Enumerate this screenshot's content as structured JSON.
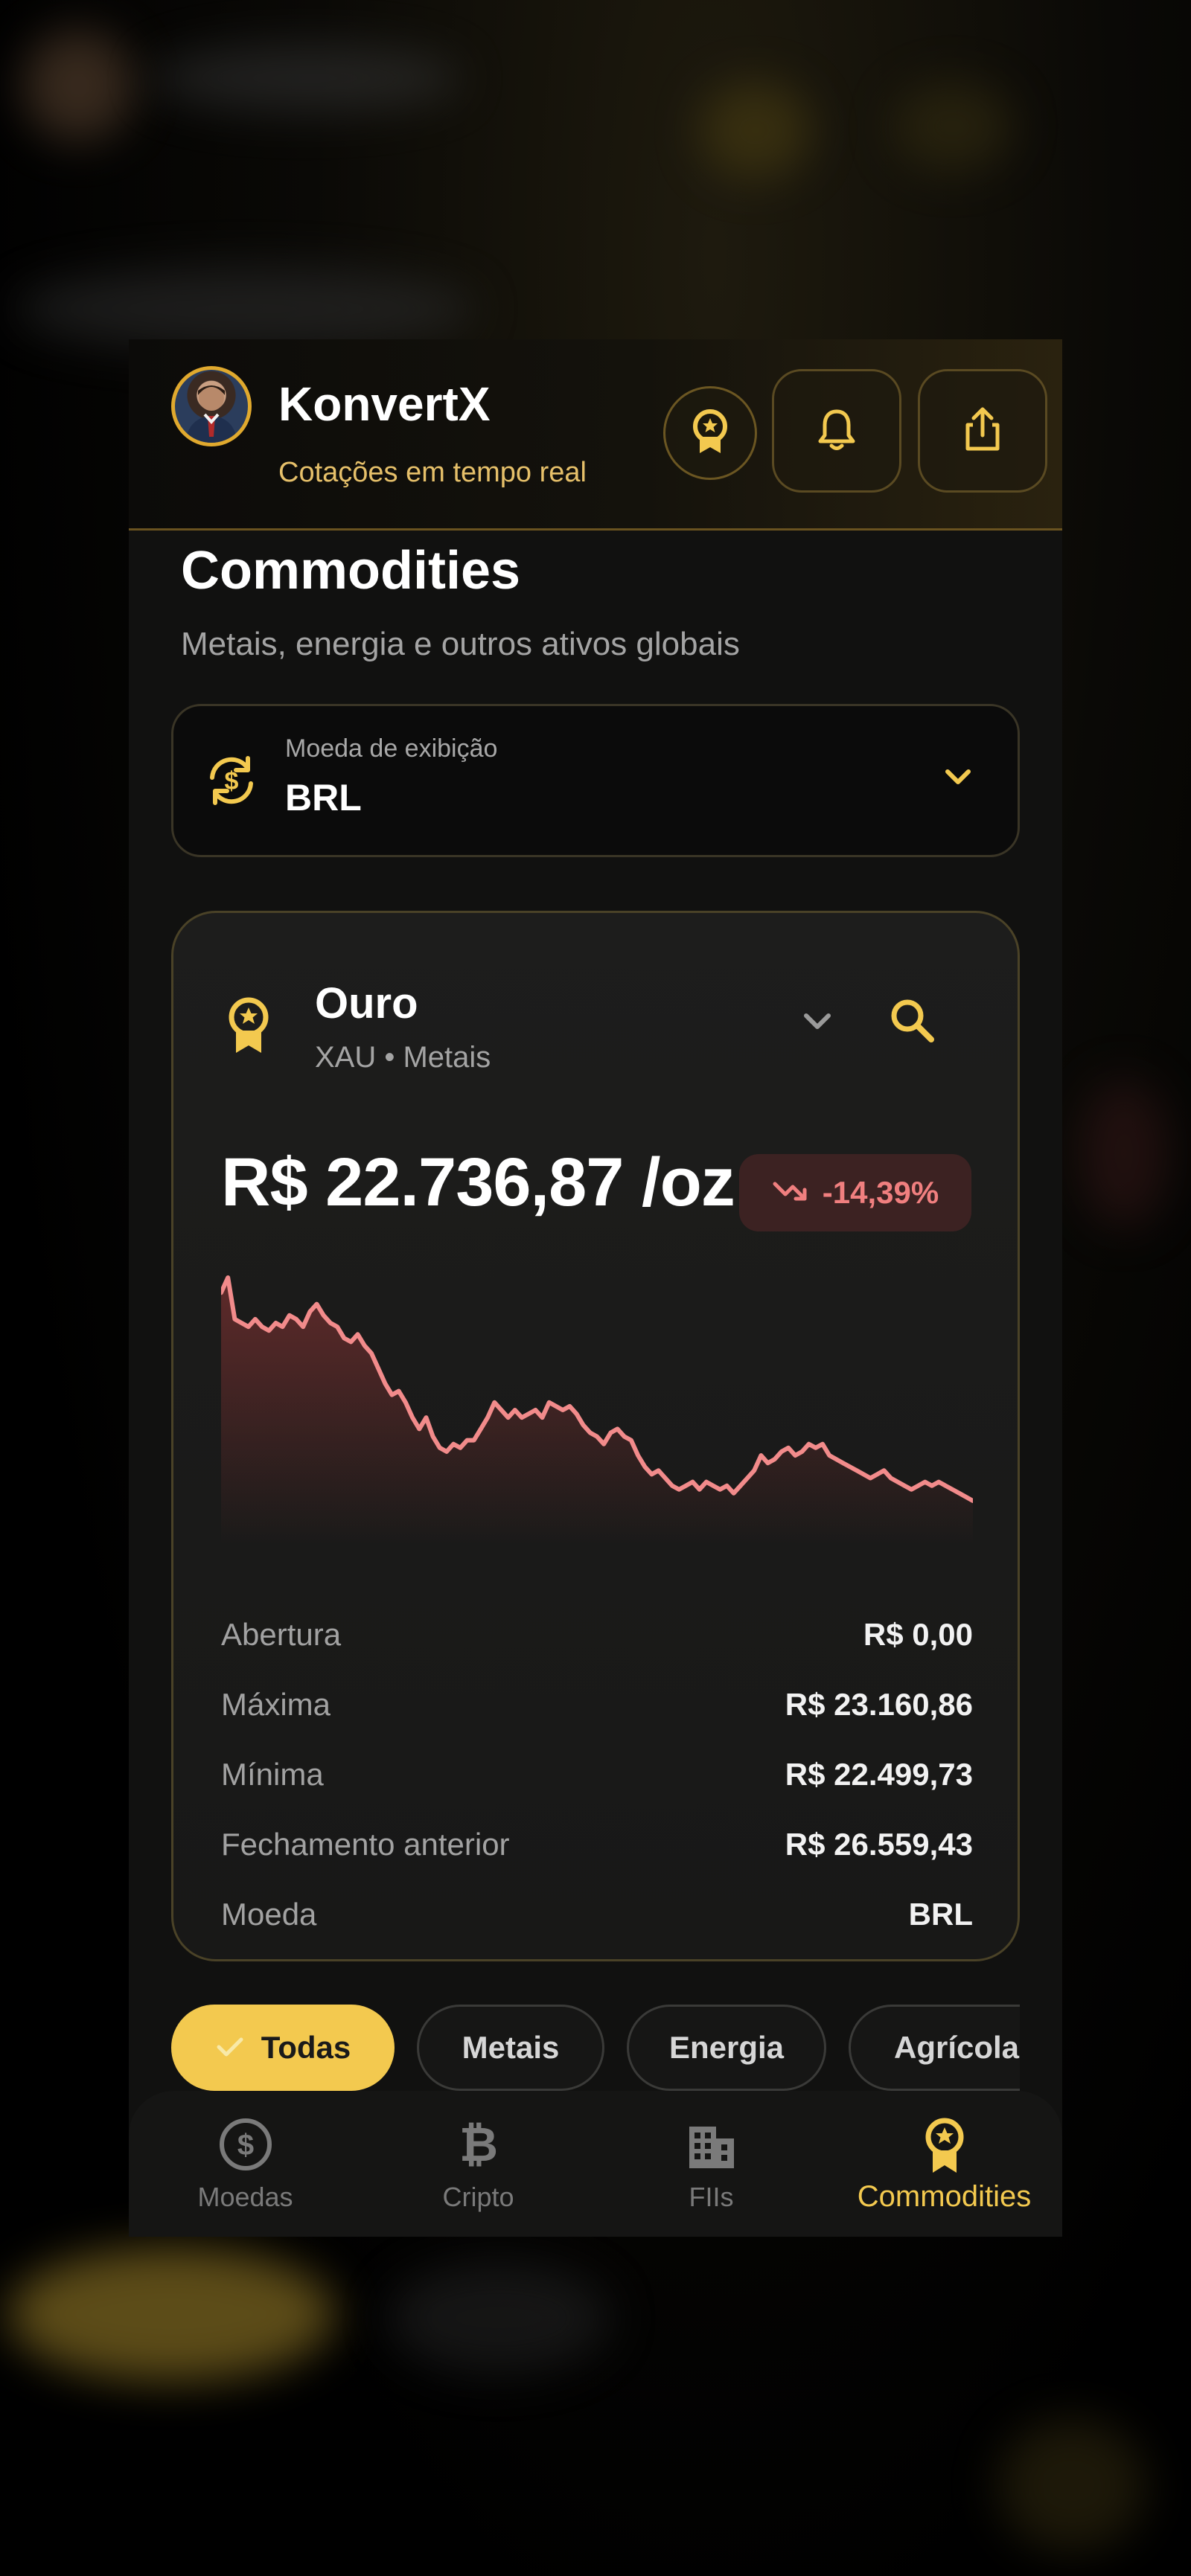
{
  "header": {
    "title": "KonvertX",
    "subtitle": "Cotações em tempo real"
  },
  "page": {
    "title": "Commodities",
    "subtitle": "Metais, energia e outros ativos globais"
  },
  "currency_selector": {
    "label": "Moeda de exibição",
    "value": "BRL"
  },
  "asset_card": {
    "name": "Ouro",
    "subtitle": "XAU • Metais",
    "price": "R$ 22.736,87 /oz",
    "change": "-14,39%",
    "change_color": "#f07f7f",
    "stats": [
      {
        "label": "Abertura",
        "value": "R$ 0,00"
      },
      {
        "label": "Máxima",
        "value": "R$ 23.160,86"
      },
      {
        "label": "Mínima",
        "value": "R$ 22.499,73"
      },
      {
        "label": "Fechamento anterior",
        "value": "R$ 26.559,43"
      },
      {
        "label": "Moeda",
        "value": "BRL"
      }
    ]
  },
  "chart_data": {
    "type": "area",
    "series": [
      {
        "values": [
          95,
          99,
          88,
          87,
          86,
          88,
          86,
          85,
          87,
          86,
          89,
          88,
          86,
          90,
          92,
          89,
          87,
          86,
          83,
          82,
          84,
          81,
          79,
          75,
          71,
          68,
          69,
          66,
          62,
          59,
          62,
          57,
          54,
          53,
          55,
          54,
          56,
          56,
          59,
          62,
          66,
          64,
          62,
          64,
          62,
          63,
          64,
          62,
          66,
          65,
          64,
          65,
          63,
          60,
          58,
          57,
          55,
          58,
          59,
          57,
          56,
          52,
          49,
          47,
          48,
          46,
          44,
          43,
          44,
          45,
          43,
          45,
          44,
          43,
          44,
          42,
          44,
          46,
          48,
          52,
          50,
          51,
          53,
          54,
          52,
          53,
          55,
          54,
          55,
          52,
          51,
          50,
          49,
          48,
          47,
          46,
          47,
          48,
          46,
          45,
          44,
          43,
          44,
          45,
          44,
          45,
          44,
          43,
          42,
          41,
          40
        ]
      }
    ],
    "line_color": "#f28b8b",
    "fill_color": "#6b2d2d",
    "axes_visible": false
  },
  "filters": [
    {
      "label": "Todas",
      "active": true
    },
    {
      "label": "Metais",
      "active": false
    },
    {
      "label": "Energia",
      "active": false
    },
    {
      "label": "Agrícolas",
      "active": false
    }
  ],
  "tabbar": [
    {
      "label": "Moedas",
      "icon": "dollar-circle-icon"
    },
    {
      "label": "Cripto",
      "icon": "bitcoin-icon"
    },
    {
      "label": "FIIs",
      "icon": "building-icon"
    },
    {
      "label": "Commodities",
      "icon": "medal-icon",
      "active": true
    }
  ],
  "colors": {
    "accent": "#f3c94f",
    "negative": "#f07f7f"
  }
}
